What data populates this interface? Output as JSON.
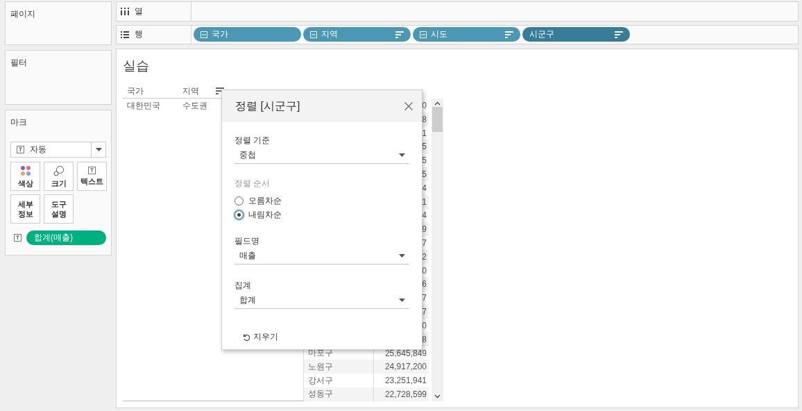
{
  "pages": {
    "title": "페이지"
  },
  "columns_shelf": {
    "label": "열"
  },
  "rows_shelf": {
    "label": "행",
    "pills": [
      {
        "label": "국가",
        "expandable": true,
        "sorted": false,
        "selected": false
      },
      {
        "label": "지역",
        "expandable": true,
        "sorted": true,
        "selected": false
      },
      {
        "label": "시도",
        "expandable": true,
        "sorted": true,
        "selected": false
      },
      {
        "label": "시군구",
        "expandable": false,
        "sorted": true,
        "selected": true
      }
    ]
  },
  "filters": {
    "title": "필터"
  },
  "marks": {
    "title": "마크",
    "type": "자동",
    "buttons": [
      {
        "kind": "color",
        "label": "색상"
      },
      {
        "kind": "size",
        "label": "크기"
      },
      {
        "kind": "text",
        "label": "텍스트"
      },
      {
        "kind": "detail",
        "label": "세부\n정보"
      },
      {
        "kind": "tooltip",
        "label": "도구\n설명"
      }
    ],
    "fields": [
      {
        "kind": "text",
        "label": "합계(매출)"
      }
    ]
  },
  "view": {
    "title": "실습",
    "headers": [
      {
        "label": "국가",
        "sorted": false
      },
      {
        "label": "지역",
        "sorted": true
      }
    ],
    "row": {
      "country": "대한민국",
      "region": "수도권"
    },
    "cells": [
      {
        "value": "0"
      },
      {
        "value": "8"
      },
      {
        "value": "1"
      },
      {
        "value": "5"
      },
      {
        "value": "5"
      },
      {
        "value": "5"
      },
      {
        "value": "4"
      },
      {
        "value": "1"
      },
      {
        "value": "4"
      },
      {
        "value": "9"
      },
      {
        "value": "7"
      },
      {
        "value": "2"
      },
      {
        "value": "0"
      },
      {
        "value": "6"
      },
      {
        "value": "7"
      },
      {
        "value": "7"
      },
      {
        "value": "0"
      },
      {
        "value": "8"
      },
      {
        "name": "마포구",
        "value": "25,645,849"
      },
      {
        "name": "노원구",
        "value": "24,917,200"
      },
      {
        "name": "강서구",
        "value": "23,251,941"
      },
      {
        "name": "성동구",
        "value": "22,728,599"
      }
    ]
  },
  "dialog": {
    "title": "정렬 [시군구]",
    "sort_by": {
      "label": "정렬 기준",
      "value": "중첩"
    },
    "order": {
      "label": "정렬 순서",
      "options": [
        {
          "label": "오름차순",
          "selected": false
        },
        {
          "label": "내림차순",
          "selected": true
        }
      ]
    },
    "field": {
      "label": "필드명",
      "value": "매출"
    },
    "aggregation": {
      "label": "집계",
      "value": "합계"
    },
    "clear_button": "지우기"
  }
}
